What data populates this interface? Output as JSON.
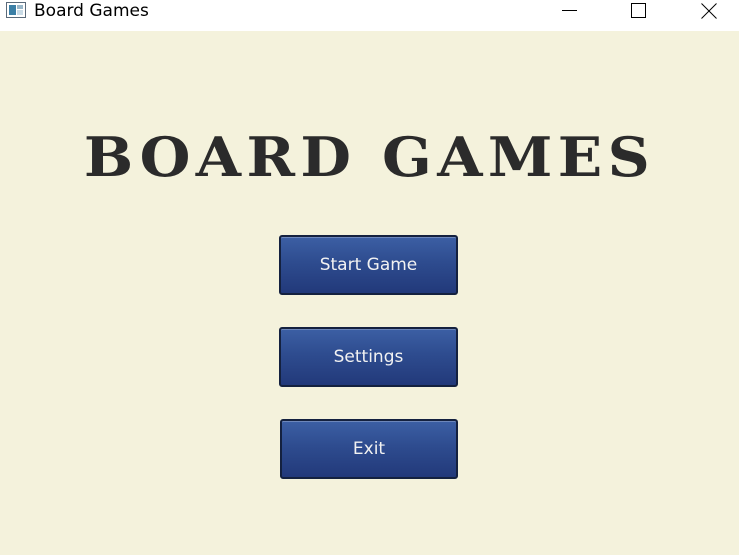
{
  "window": {
    "title": "Board Games",
    "background_color": "#f4f2dc",
    "controls": {
      "minimize": "minimize-icon",
      "maximize": "maximize-icon",
      "close": "close-icon"
    }
  },
  "main": {
    "heading": "BOARD GAMES",
    "buttons": [
      {
        "label": "Start Game"
      },
      {
        "label": "Settings"
      },
      {
        "label": "Exit"
      }
    ]
  },
  "colors": {
    "heading_text": "#2b2b2b",
    "button_fill": "#2e4c8f",
    "button_border": "#14213f",
    "button_text": "#f2f2f2"
  }
}
